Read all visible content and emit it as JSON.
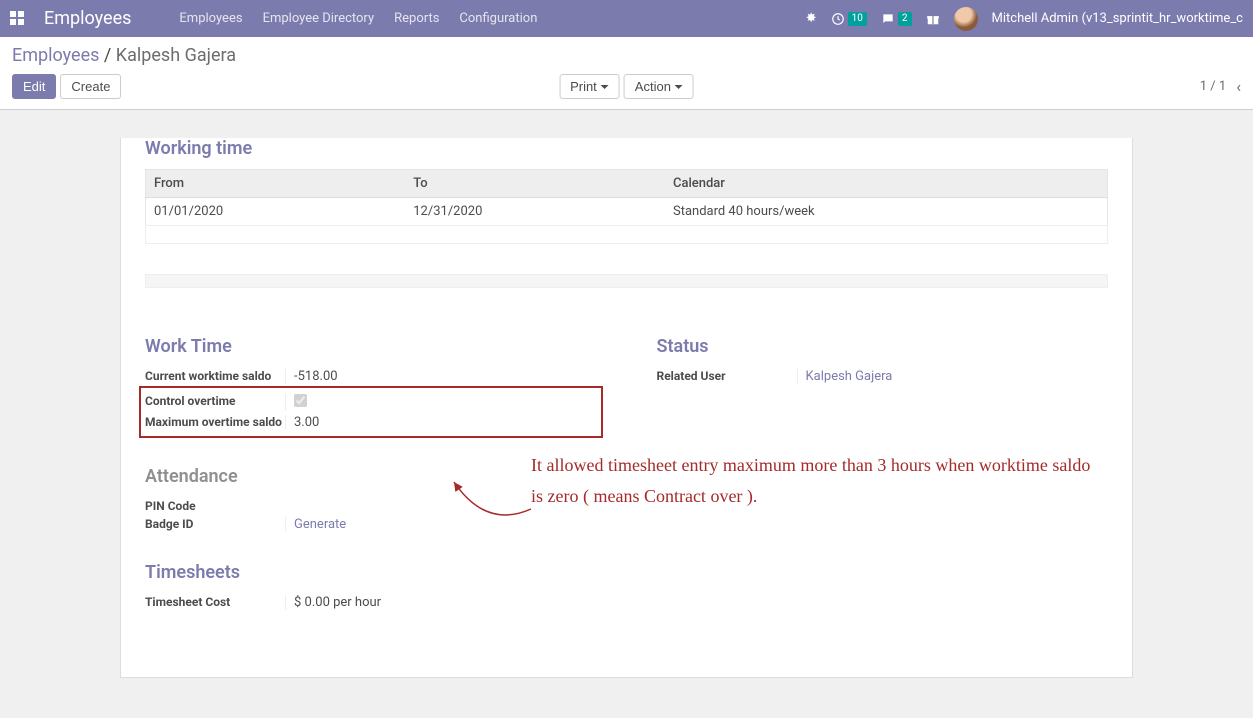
{
  "navbar": {
    "brand": "Employees",
    "menu": [
      "Employees",
      "Employee Directory",
      "Reports",
      "Configuration"
    ],
    "systray": {
      "activity_count": "10",
      "messages_count": "2",
      "user_label": "Mitchell Admin (v13_sprintit_hr_worktime_c"
    }
  },
  "breadcrumb": {
    "parent": "Employees",
    "current": "Kalpesh Gajera"
  },
  "buttons": {
    "edit": "Edit",
    "create": "Create",
    "print": "Print",
    "action": "Action"
  },
  "pager": {
    "position": "1 / 1"
  },
  "working_time": {
    "title": "Working time",
    "headers": {
      "from": "From",
      "to": "To",
      "calendar": "Calendar"
    },
    "rows": [
      {
        "from": "01/01/2020",
        "to": "12/31/2020",
        "calendar": "Standard 40 hours/week"
      }
    ]
  },
  "work_time": {
    "title": "Work Time",
    "current_label": "Current worktime saldo",
    "current_value": "-518.00",
    "control_label": "Control overtime",
    "control_checked": true,
    "max_label": "Maximum overtime saldo",
    "max_value": "3.00"
  },
  "status": {
    "title": "Status",
    "related_label": "Related User",
    "related_value": "Kalpesh Gajera"
  },
  "attendance": {
    "title": "Attendance",
    "pin_label": "PIN Code",
    "badge_label": "Badge ID",
    "generate": "Generate"
  },
  "timesheets": {
    "title": "Timesheets",
    "cost_label": "Timesheet Cost",
    "cost_value": "$ 0.00 per hour"
  },
  "annotation": {
    "text": "It allowed timesheet entry maximum more than 3 hours when worktime saldo is zero ( means Contract over )."
  }
}
